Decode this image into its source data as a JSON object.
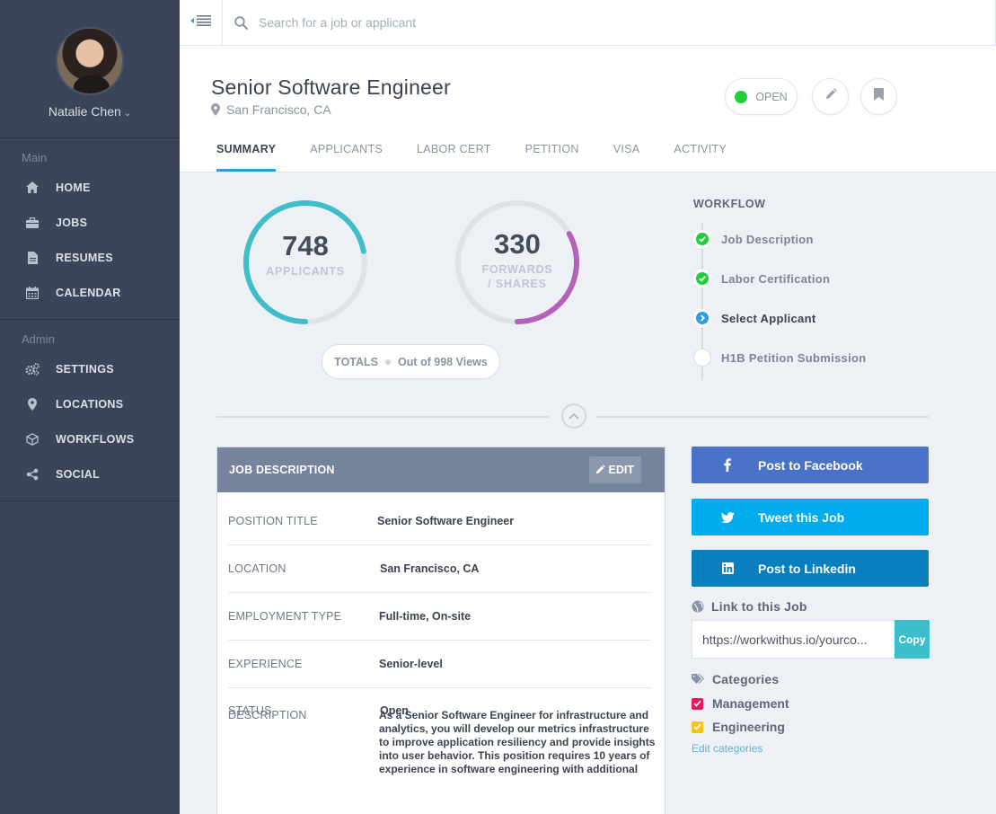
{
  "user": {
    "name": "Natalie Chen"
  },
  "sidebar": {
    "sections": [
      {
        "heading": "Main",
        "items": [
          {
            "label": "HOME",
            "icon": "home-icon"
          },
          {
            "label": "JOBS",
            "icon": "briefcase-icon"
          },
          {
            "label": "RESUMES",
            "icon": "document-icon"
          },
          {
            "label": "CALENDAR",
            "icon": "calendar-icon"
          }
        ]
      },
      {
        "heading": "Admin",
        "items": [
          {
            "label": "SETTINGS",
            "icon": "gears-icon"
          },
          {
            "label": "LOCATIONS",
            "icon": "map-pin-icon"
          },
          {
            "label": "WORKFLOWS",
            "icon": "cube-icon"
          },
          {
            "label": "SOCIAL",
            "icon": "share-icon"
          }
        ]
      }
    ]
  },
  "search": {
    "placeholder": "Search for a job or applicant"
  },
  "job": {
    "title": "Senior Software Engineer",
    "location": "San Francisco, CA",
    "status": "OPEN"
  },
  "tabs": [
    "SUMMARY",
    "APPLICANTS",
    "LABOR CERT",
    "PETITION",
    "VISA",
    "ACTIVITY"
  ],
  "stats": {
    "applicants": {
      "value": "748",
      "label": "APPLICANTS",
      "progress": 0.72
    },
    "forwards": {
      "value": "330",
      "label_line1": "FORWARDS",
      "label_line2": "/ SHARES",
      "progress": 0.33
    },
    "totals_label": "TOTALS",
    "totals_note": "Out of 998 Views"
  },
  "workflow": {
    "title": "WORKFLOW",
    "steps": [
      {
        "label": "Job Description",
        "state": "done"
      },
      {
        "label": "Labor Certification",
        "state": "done"
      },
      {
        "label": "Select Applicant",
        "state": "current"
      },
      {
        "label": "H1B Petition Submission",
        "state": "pending"
      }
    ]
  },
  "job_description": {
    "title": "JOB DESCRIPTION",
    "edit_label": "EDIT",
    "rows": [
      {
        "key": "POSITION TITLE",
        "value": "Senior Software Engineer"
      },
      {
        "key": "LOCATION",
        "value": "San Francisco, CA"
      },
      {
        "key": "EMPLOYMENT TYPE",
        "value": "Full-time, On-site"
      },
      {
        "key": "EXPERIENCE",
        "value": "Senior-level"
      },
      {
        "key": "STATUS",
        "value": "Open"
      }
    ],
    "description_key": "DESCRIPTION",
    "description_value": "As a Senior Software Engineer for infrastructure and analytics, you will develop our metrics infrastructure to improve application resiliency and provide insights into user behavior.  This position requires 10 years of experience in software engineering with additional"
  },
  "share": {
    "facebook": "Post to Facebook",
    "twitter": "Tweet this Job",
    "linkedin": "Post to Linkedin",
    "link_heading": "Link to this Job",
    "link_value": "https://workwithus.io/yourco...",
    "copy_label": "Copy"
  },
  "categories": {
    "heading": "Categories",
    "items": [
      {
        "label": "Management",
        "color": "#e8185c"
      },
      {
        "label": "Engineering",
        "color": "#f5c518"
      }
    ],
    "edit_link": "Edit categories"
  },
  "colors": {
    "sidebar_bg": "#3a4559",
    "accent_teal": "#3fbec9",
    "accent_purple": "#b561b8",
    "status_green": "#1fcf3a",
    "facebook": "#4a72c9",
    "twitter": "#00acee",
    "linkedin": "#0a7fbe"
  }
}
